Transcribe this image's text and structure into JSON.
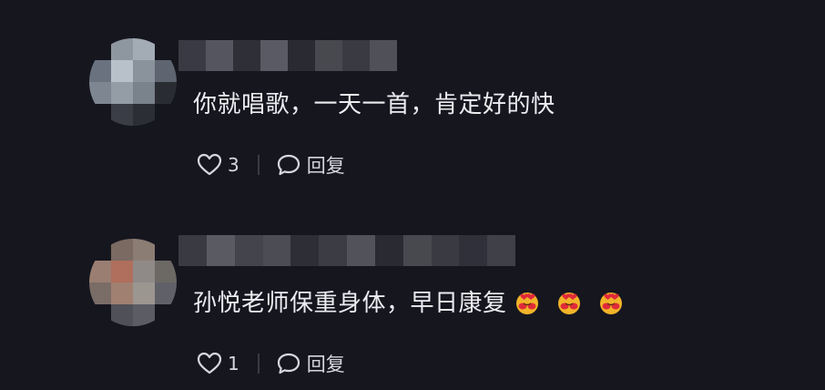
{
  "comments": [
    {
      "text": "你就唱歌，一天一首，肯定好的快",
      "like_count": "3",
      "reply_label": "回复",
      "avatar_colors": [
        "#16161f",
        "#8e96a0",
        "#a3abb5",
        "#16161f",
        "#6a7280",
        "#b8c0ca",
        "#8a929c",
        "#5e6470",
        "#7e8692",
        "#949ca6",
        "#7a828c",
        "#2a2c34",
        "#16161f",
        "#3a3c46",
        "#2c2e36",
        "#16161f"
      ],
      "name_colors": [
        "#3a3a44",
        "#55555f",
        "#2f2f38",
        "#5a5a64",
        "#2a2a32",
        "#48484f",
        "#3a3a42",
        "#505058"
      ],
      "icons": {
        "like": "heart-outline-icon",
        "reply": "speech-bubble-icon"
      }
    },
    {
      "text": "孙悦老师保重身体，早日康复",
      "emoji_count": 3,
      "like_count": "1",
      "reply_label": "回复",
      "avatar_colors": [
        "#16161f",
        "#7a6a62",
        "#8c7d74",
        "#16161f",
        "#9a7e72",
        "#b06e5c",
        "#8f8a88",
        "#6c6864",
        "#7a6c66",
        "#a08070",
        "#9c9690",
        "#606068",
        "#16161f",
        "#505058",
        "#5c5c64",
        "#16161f"
      ],
      "name_colors": [
        "#3a3a42",
        "#5a5a62",
        "#44444c",
        "#4c4c54",
        "#2e2e36",
        "#3c3c44",
        "#52525a",
        "#2a2a32",
        "#48484f",
        "#3a3a42",
        "#30303a",
        "#404048"
      ],
      "icons": {
        "like": "heart-outline-icon",
        "reply": "speech-bubble-icon",
        "emoji": "heart-hug-emoji-icon"
      }
    }
  ]
}
